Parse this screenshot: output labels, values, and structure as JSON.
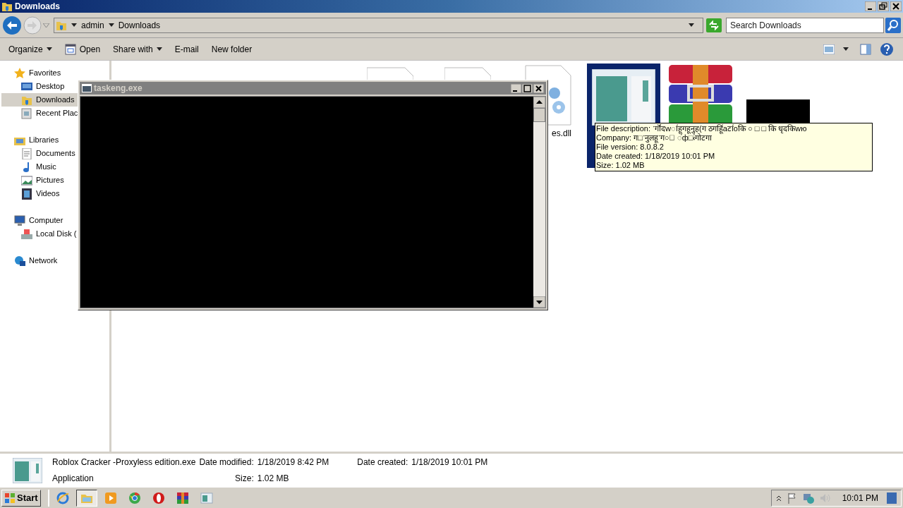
{
  "window": {
    "title": "Downloads"
  },
  "breadcrumb": [
    "admin",
    "Downloads"
  ],
  "search": {
    "placeholder": "Search Downloads"
  },
  "toolbar": [
    {
      "kind": "menu",
      "label": "Organize"
    },
    {
      "kind": "app",
      "label": "Open"
    },
    {
      "kind": "menu",
      "label": "Share with"
    },
    {
      "kind": "plain",
      "label": "E-mail"
    },
    {
      "kind": "plain",
      "label": "New folder"
    }
  ],
  "nav": [
    {
      "kind": "star",
      "label": "Favorites",
      "selected": false,
      "children": [
        {
          "kind": "desktop",
          "label": "Desktop",
          "selected": false
        },
        {
          "kind": "download",
          "label": "Downloads",
          "selected": true
        },
        {
          "kind": "recent",
          "label": "Recent Plac",
          "selected": false
        }
      ]
    },
    {
      "kind": "library",
      "label": "Libraries",
      "selected": false,
      "children": [
        {
          "kind": "document",
          "label": "Documents",
          "selected": false
        },
        {
          "kind": "music",
          "label": "Music",
          "selected": false
        },
        {
          "kind": "picture",
          "label": "Pictures",
          "selected": false
        },
        {
          "kind": "video",
          "label": "Videos",
          "selected": false
        }
      ]
    },
    {
      "kind": "computer",
      "label": "Computer",
      "selected": false,
      "children": [
        {
          "kind": "disk",
          "label": "Local Disk (",
          "selected": false
        }
      ]
    },
    {
      "kind": "network",
      "label": "Network",
      "selected": false
    }
  ],
  "files": [
    {
      "kind": "blank",
      "selected": false
    },
    {
      "kind": "blank",
      "selected": false
    },
    {
      "kind": "dll",
      "name": "es.dll",
      "selected": false
    },
    {
      "kind": "app",
      "selected": true
    },
    {
      "kind": "archive",
      "selected": false
    },
    {
      "kind": "black",
      "selected": false
    }
  ],
  "console": {
    "title": "taskeng.exe"
  },
  "tooltip": [
    "File description:  ॱगॊ॔॔दwा॔हूगहूनुह(ग ठगहूि॔aटा॔oकि ○ □ □ कि धृदकिwю",
    "Company: ग□ॱनुलहूॱग○॔ ॔ф□‹॔गोटगा",
    "File version: 8.0.8.2",
    "Date created: 1/18/2019 10:01 PM",
    "Size: 1.02 MB"
  ],
  "details": {
    "name": "Roblox Cracker -Proxyless edition.exe",
    "type": "Application",
    "modified_label": "Date modified:",
    "modified": "1/18/2019 8:42 PM",
    "created_label": "Date created:",
    "created": "1/18/2019 10:01 PM",
    "size_label": "Size:",
    "size": "1.02 MB"
  },
  "taskbar": {
    "start": "Start",
    "buttons": [
      {
        "kind": "ie",
        "selected": false
      },
      {
        "kind": "explorer",
        "selected": true
      },
      {
        "kind": "media",
        "selected": false
      },
      {
        "kind": "chrome",
        "selected": false
      },
      {
        "kind": "opera",
        "selected": false
      },
      {
        "kind": "winrar",
        "selected": false
      },
      {
        "kind": "window",
        "selected": false
      }
    ],
    "clock": "10:01 PM"
  }
}
